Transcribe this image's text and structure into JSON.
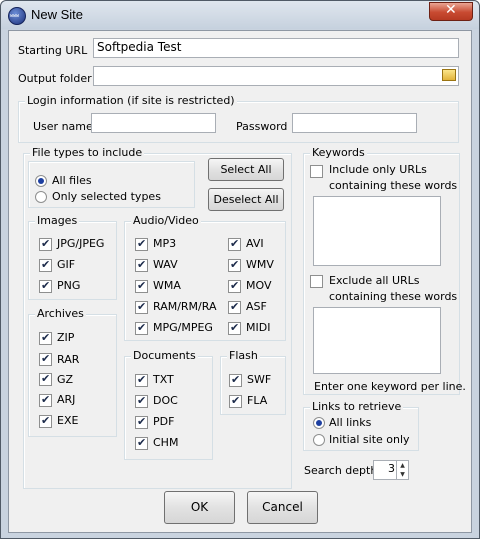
{
  "window": {
    "title": "New Site"
  },
  "general": {
    "starting_url_label": "Starting URL",
    "starting_url_value": "Softpedia Test",
    "output_folder_label": "Output folder",
    "output_folder_value": ""
  },
  "login": {
    "legend": "Login information (if site is restricted)",
    "user_label": "User name",
    "user_value": "",
    "password_label": "Password",
    "password_value": ""
  },
  "filetypes": {
    "legend": "File types to include",
    "all_files": "All files",
    "only_selected": "Only selected types",
    "selected_mode": "all",
    "select_all": "Select All",
    "deselect_all": "Deselect All"
  },
  "images": {
    "legend": "Images",
    "items": [
      {
        "label": "JPG/JPEG",
        "checked": true
      },
      {
        "label": "GIF",
        "checked": true
      },
      {
        "label": "PNG",
        "checked": true
      }
    ]
  },
  "archives": {
    "legend": "Archives",
    "items": [
      {
        "label": "ZIP",
        "checked": true
      },
      {
        "label": "RAR",
        "checked": true
      },
      {
        "label": "GZ",
        "checked": true
      },
      {
        "label": "ARJ",
        "checked": true
      },
      {
        "label": "EXE",
        "checked": true
      }
    ]
  },
  "audio_video": {
    "legend": "Audio/Video",
    "col1": [
      {
        "label": "MP3",
        "checked": true
      },
      {
        "label": "WAV",
        "checked": true
      },
      {
        "label": "WMA",
        "checked": true
      },
      {
        "label": "RAM/RM/RA",
        "checked": true
      },
      {
        "label": "MPG/MPEG",
        "checked": true
      }
    ],
    "col2": [
      {
        "label": "AVI",
        "checked": true
      },
      {
        "label": "WMV",
        "checked": true
      },
      {
        "label": "MOV",
        "checked": true
      },
      {
        "label": "ASF",
        "checked": true
      },
      {
        "label": "MIDI",
        "checked": true
      }
    ]
  },
  "documents": {
    "legend": "Documents",
    "items": [
      {
        "label": "TXT",
        "checked": true
      },
      {
        "label": "DOC",
        "checked": true
      },
      {
        "label": "PDF",
        "checked": true
      },
      {
        "label": "CHM",
        "checked": true
      }
    ]
  },
  "flash": {
    "legend": "Flash",
    "items": [
      {
        "label": "SWF",
        "checked": true
      },
      {
        "label": "FLA",
        "checked": true
      }
    ]
  },
  "keywords": {
    "legend": "Keywords",
    "include_label_1": "Include only URLs",
    "include_label_2": "containing these words",
    "include_checked": false,
    "exclude_label_1": "Exclude all URLs",
    "exclude_label_2": "containing these words",
    "exclude_checked": false,
    "hint": "Enter one keyword per line."
  },
  "links": {
    "legend": "Links to retrieve",
    "all_links": "All links",
    "initial_only": "Initial site only",
    "selected": "all"
  },
  "depth": {
    "label": "Search depth",
    "value": "3"
  },
  "buttons": {
    "ok": "OK",
    "cancel": "Cancel"
  },
  "colors": {
    "close_button": "#c84a31",
    "window_frame": "#c9d3df",
    "dialog_bg": "#f0f0f0"
  }
}
